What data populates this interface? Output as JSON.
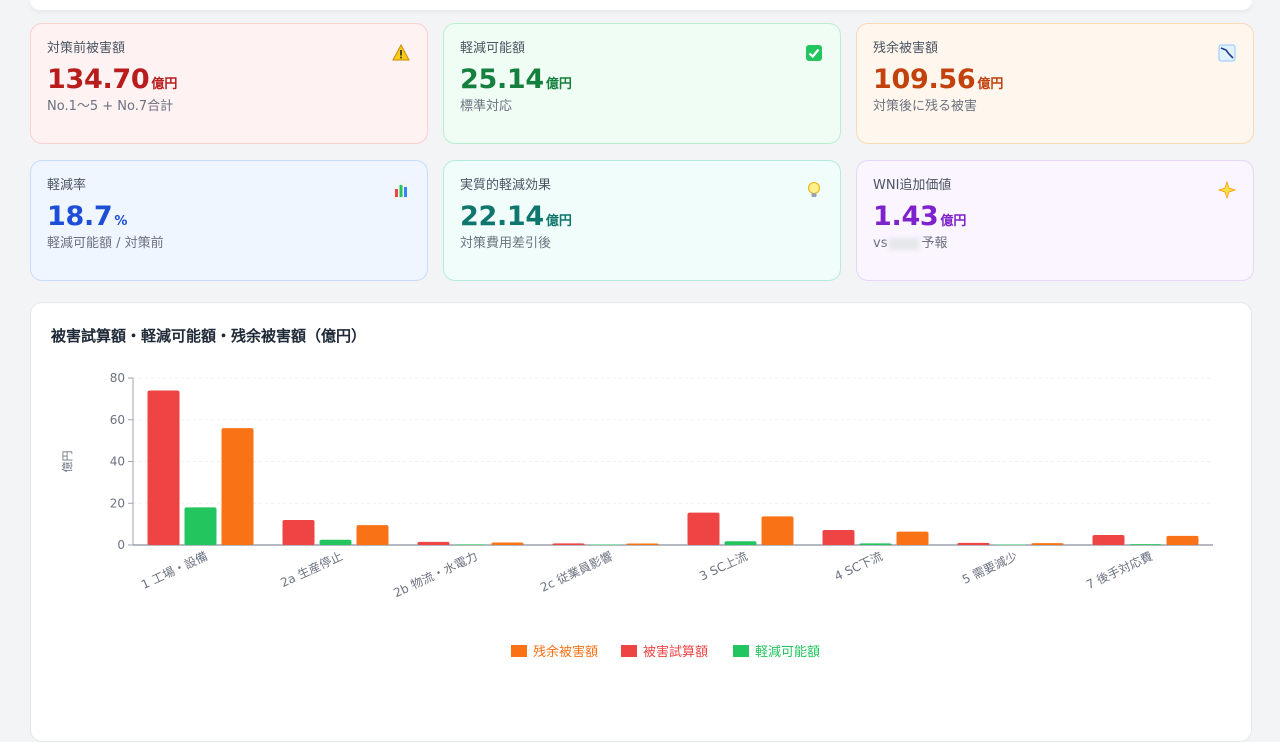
{
  "cards": [
    {
      "label": "対策前被害額",
      "value": "134.70",
      "unit": "億円",
      "sub": "No.1〜5 + No.7合計",
      "icon": "warning-icon",
      "color": "#b91c1c"
    },
    {
      "label": "軽減可能額",
      "value": "25.14",
      "unit": "億円",
      "sub": "標準対応",
      "icon": "check-icon",
      "color": "#15803d"
    },
    {
      "label": "残余被害額",
      "value": "109.56",
      "unit": "億円",
      "sub": "対策後に残る被害",
      "icon": "chart-down-icon",
      "color": "#c2410c"
    },
    {
      "label": "軽減率",
      "value": "18.7",
      "unit": "%",
      "sub": "軽減可能額 / 対策前",
      "icon": "bar-chart-icon",
      "color": "#1d4ed8"
    },
    {
      "label": "実質的軽減効果",
      "value": "22.14",
      "unit": "億円",
      "sub": "対策費用差引後",
      "icon": "lightbulb-icon",
      "color": "#0f766e"
    },
    {
      "label": "WNI追加価値",
      "value": "1.43",
      "unit": "億円",
      "sub_prefix": "vs",
      "sub_suffix": "予報",
      "icon": "sparkle-icon",
      "color": "#7e22ce"
    }
  ],
  "chart_title": "被害試算額・軽減可能額・残余被害額（億円）",
  "chart_data": {
    "type": "bar",
    "title": "被害試算額・軽減可能額・残余被害額（億円）",
    "xlabel": "",
    "ylabel": "億円",
    "ylim": [
      0,
      80
    ],
    "yticks": [
      0,
      20,
      40,
      60,
      80
    ],
    "grid": true,
    "legend_position": "bottom",
    "categories": [
      "1 工場・設備",
      "2a 生産停止",
      "2b 物流・水電力",
      "2c 従業員影響",
      "3 SC上流",
      "4 SC下流",
      "5 需要減少",
      "7 後手対応費"
    ],
    "series": [
      {
        "name": "被害試算額",
        "color": "#ef4444",
        "values": [
          74.0,
          12.0,
          1.5,
          0.8,
          15.5,
          7.2,
          1.0,
          4.8
        ]
      },
      {
        "name": "軽減可能額",
        "color": "#22c55e",
        "values": [
          18.0,
          2.5,
          0.3,
          0.1,
          1.8,
          0.8,
          0.1,
          0.4
        ]
      },
      {
        "name": "残余被害額",
        "color": "#f97316",
        "values": [
          56.0,
          9.5,
          1.2,
          0.7,
          13.7,
          6.4,
          0.9,
          4.4
        ]
      }
    ],
    "legend": [
      {
        "name": "残余被害額",
        "color": "#f97316"
      },
      {
        "name": "被害試算額",
        "color": "#ef4444"
      },
      {
        "name": "軽減可能額",
        "color": "#22c55e"
      }
    ]
  }
}
